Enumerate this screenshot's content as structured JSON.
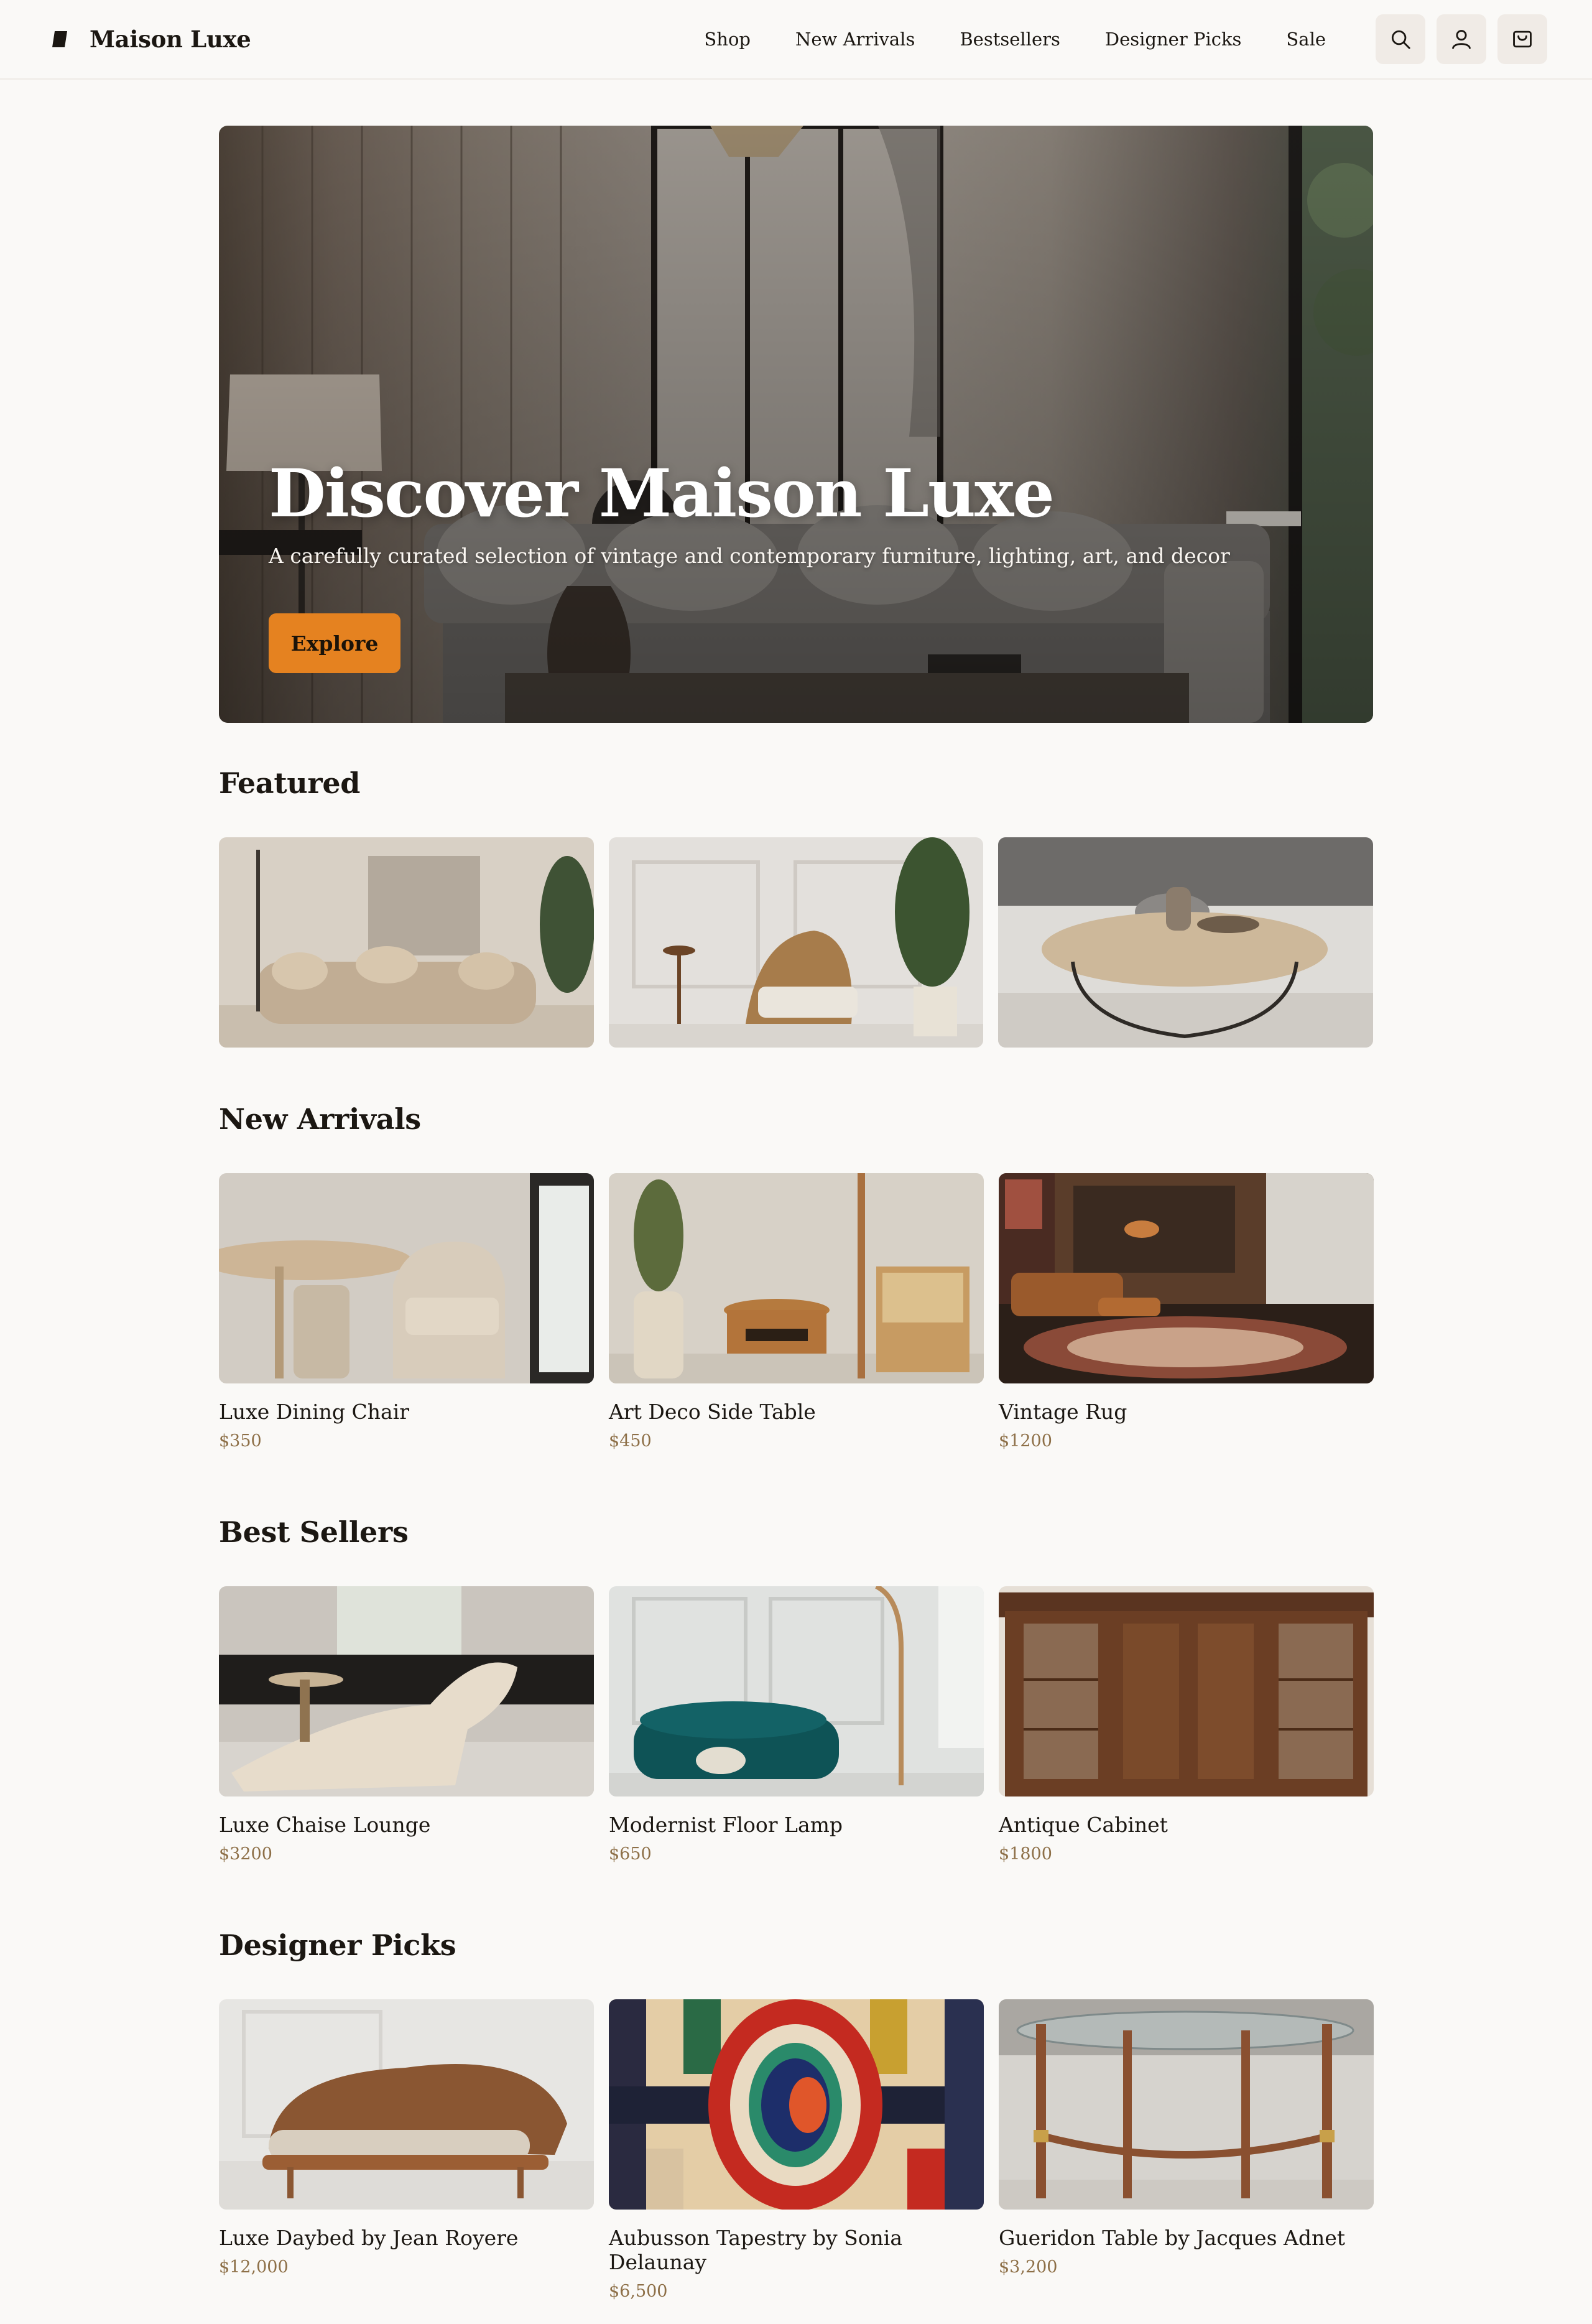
{
  "brand": {
    "name": "Maison Luxe",
    "logo_icon": "brand-mark-icon"
  },
  "nav": {
    "links": [
      "Shop",
      "New Arrivals",
      "Bestsellers",
      "Designer Picks",
      "Sale"
    ],
    "icons": [
      "search-icon",
      "user-icon",
      "cart-icon"
    ]
  },
  "hero": {
    "title": "Discover Maison Luxe",
    "subtitle": "A carefully curated selection of vintage and contemporary furniture, lighting, art, and decor",
    "button_label": "Explore"
  },
  "featured": {
    "title": "Featured"
  },
  "new_arrivals": {
    "title": "New Arrivals",
    "items": [
      {
        "name": "Luxe Dining Chair",
        "price": "$350"
      },
      {
        "name": "Art Deco Side Table",
        "price": "$450"
      },
      {
        "name": "Vintage Rug",
        "price": "$1200"
      }
    ]
  },
  "best_sellers": {
    "title": "Best Sellers",
    "items": [
      {
        "name": "Luxe Chaise Lounge",
        "price": "$3200"
      },
      {
        "name": "Modernist Floor Lamp",
        "price": "$650"
      },
      {
        "name": "Antique Cabinet",
        "price": "$1800"
      }
    ]
  },
  "designer_picks": {
    "title": "Designer Picks",
    "items": [
      {
        "name": "Luxe Daybed by Jean Royere",
        "price": "$12,000"
      },
      {
        "name": "Aubusson Tapestry by Sonia Delaunay",
        "price": "$6,500"
      },
      {
        "name": "Gueridon Table by Jacques Adnet",
        "price": "$3,200"
      }
    ]
  },
  "colors": {
    "accent": "#e58220",
    "price": "#8d6f47",
    "background": "#faf9f7"
  }
}
